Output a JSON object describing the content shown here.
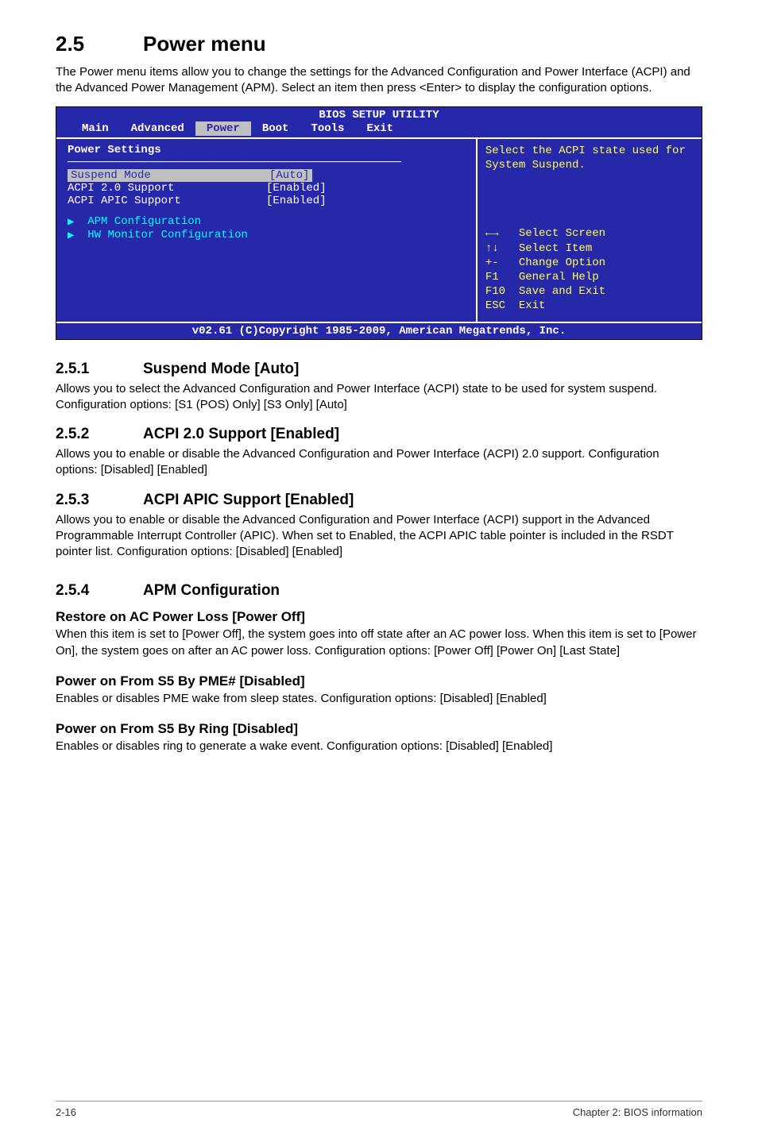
{
  "heading": {
    "num": "2.5",
    "title": "Power menu"
  },
  "intro": "The Power menu items allow you to change the settings for the Advanced Configuration and Power Interface (ACPI) and the Advanced Power Management (APM). Select an item then press <Enter> to display the configuration options.",
  "bios": {
    "title": "BIOS SETUP UTILITY",
    "tabs": [
      "Main",
      "Advanced",
      "Power",
      "Boot",
      "Tools",
      "Exit"
    ],
    "active_tab": "Power",
    "section_header": "Power Settings",
    "options": {
      "suspend_mode": {
        "label": "Suspend Mode",
        "value": "[Auto]",
        "selected": true
      },
      "acpi20": {
        "label": "ACPI 2.0 Support",
        "value": "[Enabled]"
      },
      "acpi_apic": {
        "label": "ACPI APIC Support",
        "value": "[Enabled]"
      }
    },
    "submenus": [
      "APM Configuration",
      "HW Monitor Configuration"
    ],
    "help_top": "Select the ACPI state used for System Suspend.",
    "nav": {
      "select_screen": "Select Screen",
      "select_item": "Select Item",
      "change_option": "Change Option",
      "general_help": "General Help",
      "save_exit": "Save and Exit",
      "exit": "Exit",
      "sym_lr": "←→",
      "sym_ud": "↑↓",
      "sym_pm": "+-",
      "sym_f1": "F1",
      "sym_f10": "F10",
      "sym_esc": "ESC"
    },
    "footer": "v02.61 (C)Copyright 1985-2009, American Megatrends, Inc."
  },
  "s251": {
    "num": "2.5.1",
    "title": "Suspend Mode [Auto]",
    "text": "Allows you to select the Advanced Configuration and Power Interface (ACPI) state to be used for system suspend. Configuration options: [S1 (POS) Only] [S3 Only] [Auto]"
  },
  "s252": {
    "num": "2.5.2",
    "title": "ACPI 2.0 Support [Enabled]",
    "text": "Allows you to enable or disable the Advanced Configuration and Power Interface (ACPI) 2.0 support. Configuration options: [Disabled] [Enabled]"
  },
  "s253": {
    "num": "2.5.3",
    "title": "ACPI APIC Support [Enabled]",
    "text": "Allows you to enable or disable the Advanced Configuration and Power Interface (ACPI) support in the Advanced Programmable Interrupt Controller (APIC). When set to Enabled, the ACPI APIC table pointer is included in the RSDT pointer list. Configuration options: [Disabled] [Enabled]"
  },
  "s254": {
    "num": "2.5.4",
    "title": "APM Configuration",
    "items": {
      "restore": {
        "h": "Restore on AC Power Loss [Power Off]",
        "t": "When this item is set to [Power Off], the system goes into off state after an AC power loss. When this item is set to [Power On], the system goes on after an AC power loss. Configuration options: [Power Off] [Power On] [Last State]"
      },
      "pme": {
        "h": "Power on From S5 By PME# [Disabled]",
        "t": "Enables or disables PME wake from sleep states. Configuration options: [Disabled] [Enabled]"
      },
      "ring": {
        "h": "Power on From S5 By Ring [Disabled]",
        "t": "Enables or disables ring to generate a wake event. Configuration options: [Disabled] [Enabled]"
      }
    }
  },
  "footer": {
    "left": "2-16",
    "right": "Chapter 2: BIOS information"
  }
}
